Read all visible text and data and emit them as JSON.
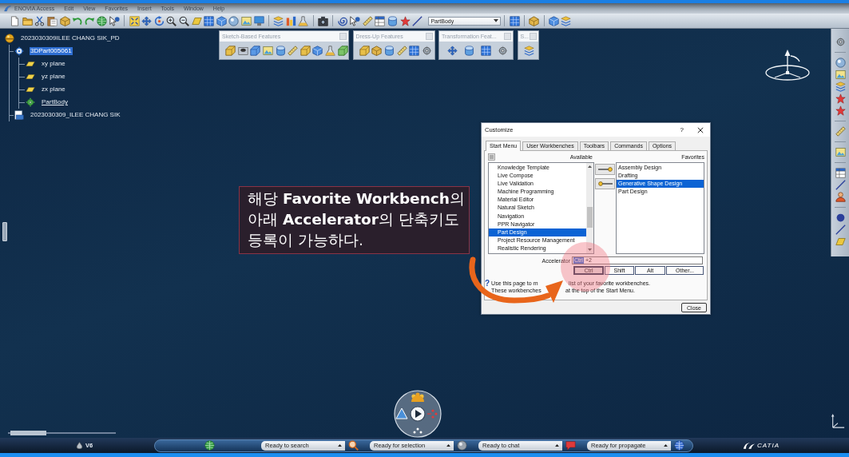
{
  "menu_bar": {
    "items": [
      "ENOVIA Access",
      "Edit",
      "View",
      "Favorites",
      "Insert",
      "Tools",
      "Window",
      "Help"
    ]
  },
  "toolbar": {
    "current_body": "PartBody"
  },
  "floating_toolbars": [
    {
      "title": "Sketch-Based Features"
    },
    {
      "title": "Dress-Up Features"
    },
    {
      "title": "Transformation Feat..."
    },
    {
      "title": "S..."
    }
  ],
  "tree": {
    "items": [
      {
        "kind": "product",
        "label": "2023030309ILEE CHANG SIK_PD",
        "selected": false,
        "children": [
          {
            "kind": "part",
            "label": "3DPart005061",
            "selected": true,
            "children": [
              {
                "kind": "plane",
                "label": "xy plane",
                "selected": false,
                "in_work": false
              },
              {
                "kind": "plane",
                "label": "yz plane",
                "selected": false,
                "in_work": false
              },
              {
                "kind": "plane",
                "label": "zx plane",
                "selected": false,
                "in_work": false
              },
              {
                "kind": "body",
                "label": "PartBody",
                "selected": false,
                "in_work": true
              }
            ]
          },
          {
            "kind": "representation",
            "label": "2023030309_ILEE CHANG SIK",
            "selected": false
          }
        ]
      }
    ]
  },
  "dialog": {
    "title": "Customize",
    "help_button": "?",
    "tabs": [
      {
        "label": "Start Menu",
        "selected": true
      },
      {
        "label": "User Workbenches",
        "selected": false
      },
      {
        "label": "Toolbars",
        "selected": false
      },
      {
        "label": "Commands",
        "selected": false
      },
      {
        "label": "Options",
        "selected": false
      }
    ],
    "available": {
      "heading": "Available",
      "items": [
        {
          "label": "Knowledge Template",
          "selected": false
        },
        {
          "label": "Live Compose",
          "selected": false
        },
        {
          "label": "Live Validation",
          "selected": false
        },
        {
          "label": "Machine Programming",
          "selected": false
        },
        {
          "label": "Material Editor",
          "selected": false
        },
        {
          "label": "Natural Sketch",
          "selected": false
        },
        {
          "label": "Navigation",
          "selected": false
        },
        {
          "label": "PPR Navigator",
          "selected": false
        },
        {
          "label": "Part Design",
          "selected": true
        },
        {
          "label": "Project Resource Management",
          "selected": false
        },
        {
          "label": "Realistic Rendering",
          "selected": false
        }
      ]
    },
    "favorites": {
      "heading": "Favorites",
      "items": [
        {
          "label": "Assembly Design",
          "selected": false
        },
        {
          "label": "Drafting",
          "selected": false
        },
        {
          "label": "Generative Shape Design",
          "selected": true
        },
        {
          "label": "Part Design",
          "selected": false
        }
      ]
    },
    "accelerator": {
      "label": "Accelerator",
      "value": [
        {
          "text": "Ctrl",
          "selected": true
        },
        {
          "text": "+2",
          "selected": false
        }
      ]
    },
    "modifiers": [
      {
        "label": "Ctrl",
        "pressed": true
      },
      {
        "label": "Shift",
        "pressed": false
      },
      {
        "label": "Alt",
        "pressed": false
      },
      {
        "label": "Other...",
        "pressed": false
      }
    ],
    "help": {
      "mark": "?",
      "lines": [
        [
          "Use this page to m",
          "list of your favorite workbenches."
        ],
        [
          "These workbenches",
          "at the top of the Start Menu."
        ]
      ]
    },
    "close_button": "Close"
  },
  "callout": {
    "lines": [
      "해당 **Favorite Workbench**의",
      "아래 **Accelerator**의 단축키도",
      "등록이 가능하다."
    ]
  },
  "taskbar": {
    "version": "V6",
    "status_fields": [
      "Ready to search",
      "Ready for selection",
      "Ready to chat",
      "Ready for propagate"
    ],
    "brand": "CATIA"
  }
}
